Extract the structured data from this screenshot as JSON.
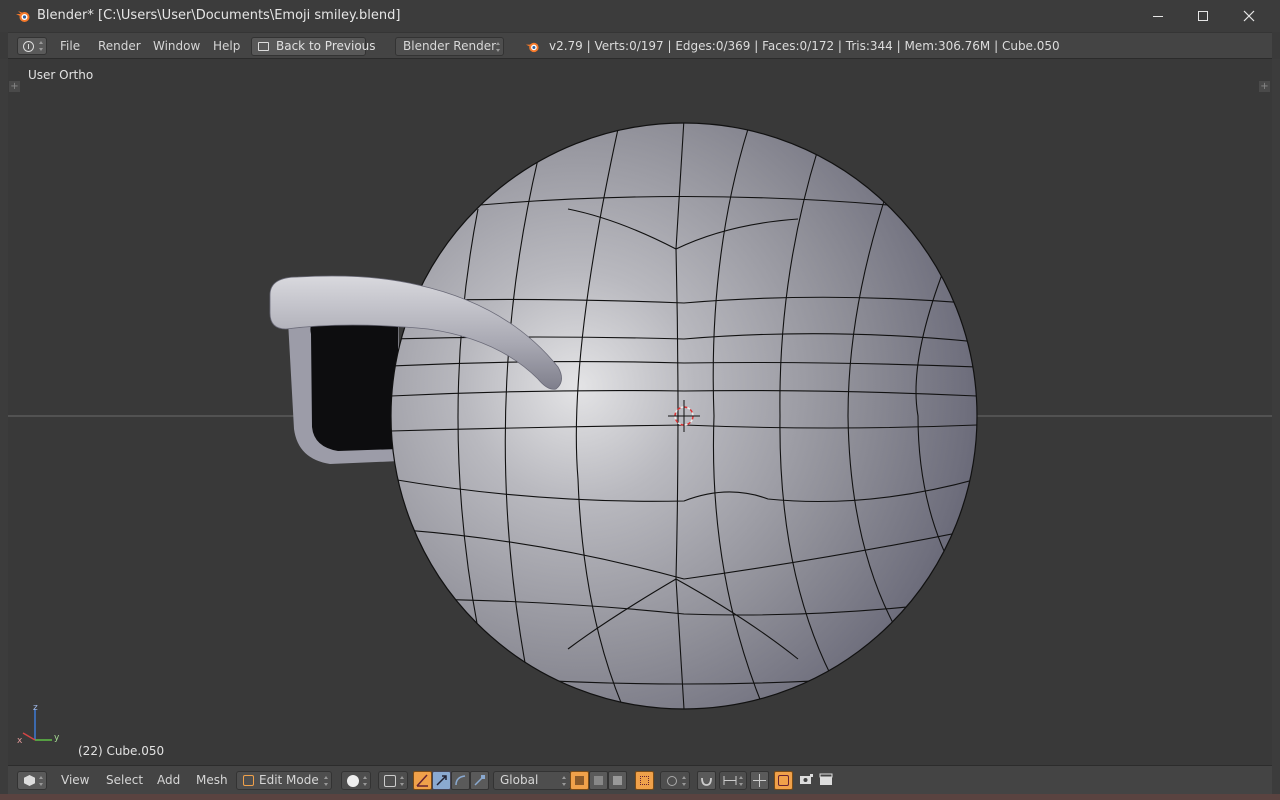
{
  "window": {
    "title": "Blender* [C:\\Users\\User\\Documents\\Emoji smiley.blend]",
    "minimize_icon": "minimize-icon",
    "maximize_icon": "maximize-icon",
    "close_icon": "close-icon"
  },
  "info_header": {
    "menus": [
      "File",
      "Render",
      "Window",
      "Help"
    ],
    "back_button": "Back to Previous",
    "render_engine": "Blender Render",
    "stats": "v2.79 | Verts:0/197 | Edges:0/369 | Faces:0/172 | Tris:344 | Mem:306.76M | Cube.050"
  },
  "viewport": {
    "view_name": "User Ortho",
    "object_info": "(22) Cube.050",
    "axis_labels": {
      "x": "x",
      "y": "y",
      "z": "z"
    },
    "colors": {
      "background": "#393939",
      "mesh": "#8f8f98",
      "wire": "#111111",
      "grid_line": "#6a6a6a"
    }
  },
  "bottom_header": {
    "menus": [
      "View",
      "Select",
      "Add",
      "Mesh"
    ],
    "mode": "Edit Mode",
    "orientation": "Global"
  },
  "colors": {
    "accent_orange": "#f0a14a",
    "header_bg": "#444444",
    "title_bg": "#3c3c3c"
  }
}
